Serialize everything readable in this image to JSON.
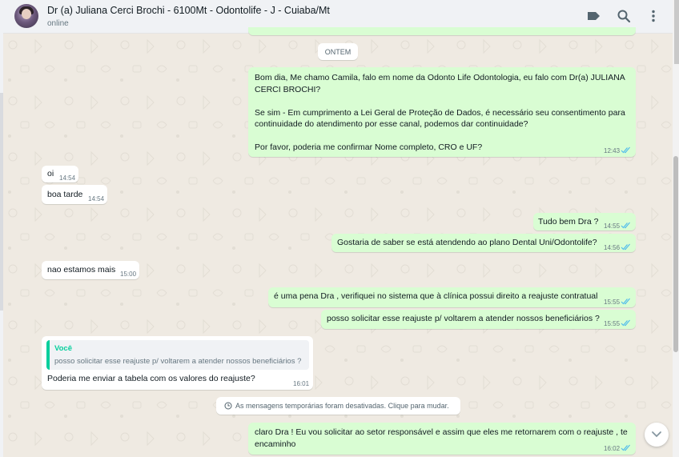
{
  "header": {
    "contact_name": "Dr (a) Juliana Cerci Brochi - 6100Mt - Odontolife - J - Cuiaba/Mt",
    "status": "online",
    "icons": [
      "label-icon",
      "search-icon",
      "menu-icon"
    ]
  },
  "chat": {
    "day_separator": "ONTEM",
    "messages": [
      {
        "direction": "out",
        "lines": [
          "Bom dia, Me chamo Camila, falo em nome da Odonto Life Odontologia, eu falo com Dr(a) JULIANA",
          "CERCI BROCHI?",
          "",
          "Se sim - Em cumprimento a Lei Geral de Proteção de Dados, é necessário seu consentimento para",
          "continuidade do atendimento por esse canal, podemos dar continuidade?",
          "",
          "Por favor, poderia me confirmar Nome completo, CRO e UF?"
        ],
        "time": "12:43",
        "read": true
      },
      {
        "direction": "in",
        "text": "oi",
        "time": "14:54"
      },
      {
        "direction": "in",
        "text": "boa tarde",
        "time": "14:54"
      },
      {
        "direction": "out",
        "text": "Tudo bem Dra ?",
        "time": "14:55",
        "read": true
      },
      {
        "direction": "out",
        "text": "Gostaria de saber se está atendendo ao plano Dental Uni/Odontolife?",
        "time": "14:56",
        "read": true
      },
      {
        "direction": "in",
        "text": "nao estamos mais",
        "time": "15:00"
      },
      {
        "direction": "out",
        "text": "é uma pena Dra , verifiquei no sistema que à clínica possui direito a reajuste contratual",
        "time": "15:55",
        "read": true
      },
      {
        "direction": "out",
        "text": "posso solicitar esse reajuste p/ voltarem a atender nossos beneficiários ?",
        "time": "15:55",
        "read": true
      },
      {
        "direction": "in",
        "quote_author": "Você",
        "quote_text": "posso solicitar esse reajuste p/ voltarem a atender nossos beneficiários ?",
        "text": "Poderia me enviar a tabela com os valores do reajuste?",
        "time": "16:01"
      },
      {
        "direction": "out",
        "lines": [
          "claro Dra ! Eu vou solicitar ao setor responsável e assim que eles me retornarem com o reajuste , te",
          "encaminho"
        ],
        "time": "16:02",
        "read": true
      }
    ],
    "system_notice": "As mensagens temporárias foram desativadas. Clique para mudar."
  },
  "colors": {
    "outgoing_bubble": "#d9fdd3",
    "incoming_bubble": "#ffffff",
    "chat_background": "#efeae2",
    "read_ticks": "#53bdeb",
    "quote_accent": "#06cf9c"
  }
}
